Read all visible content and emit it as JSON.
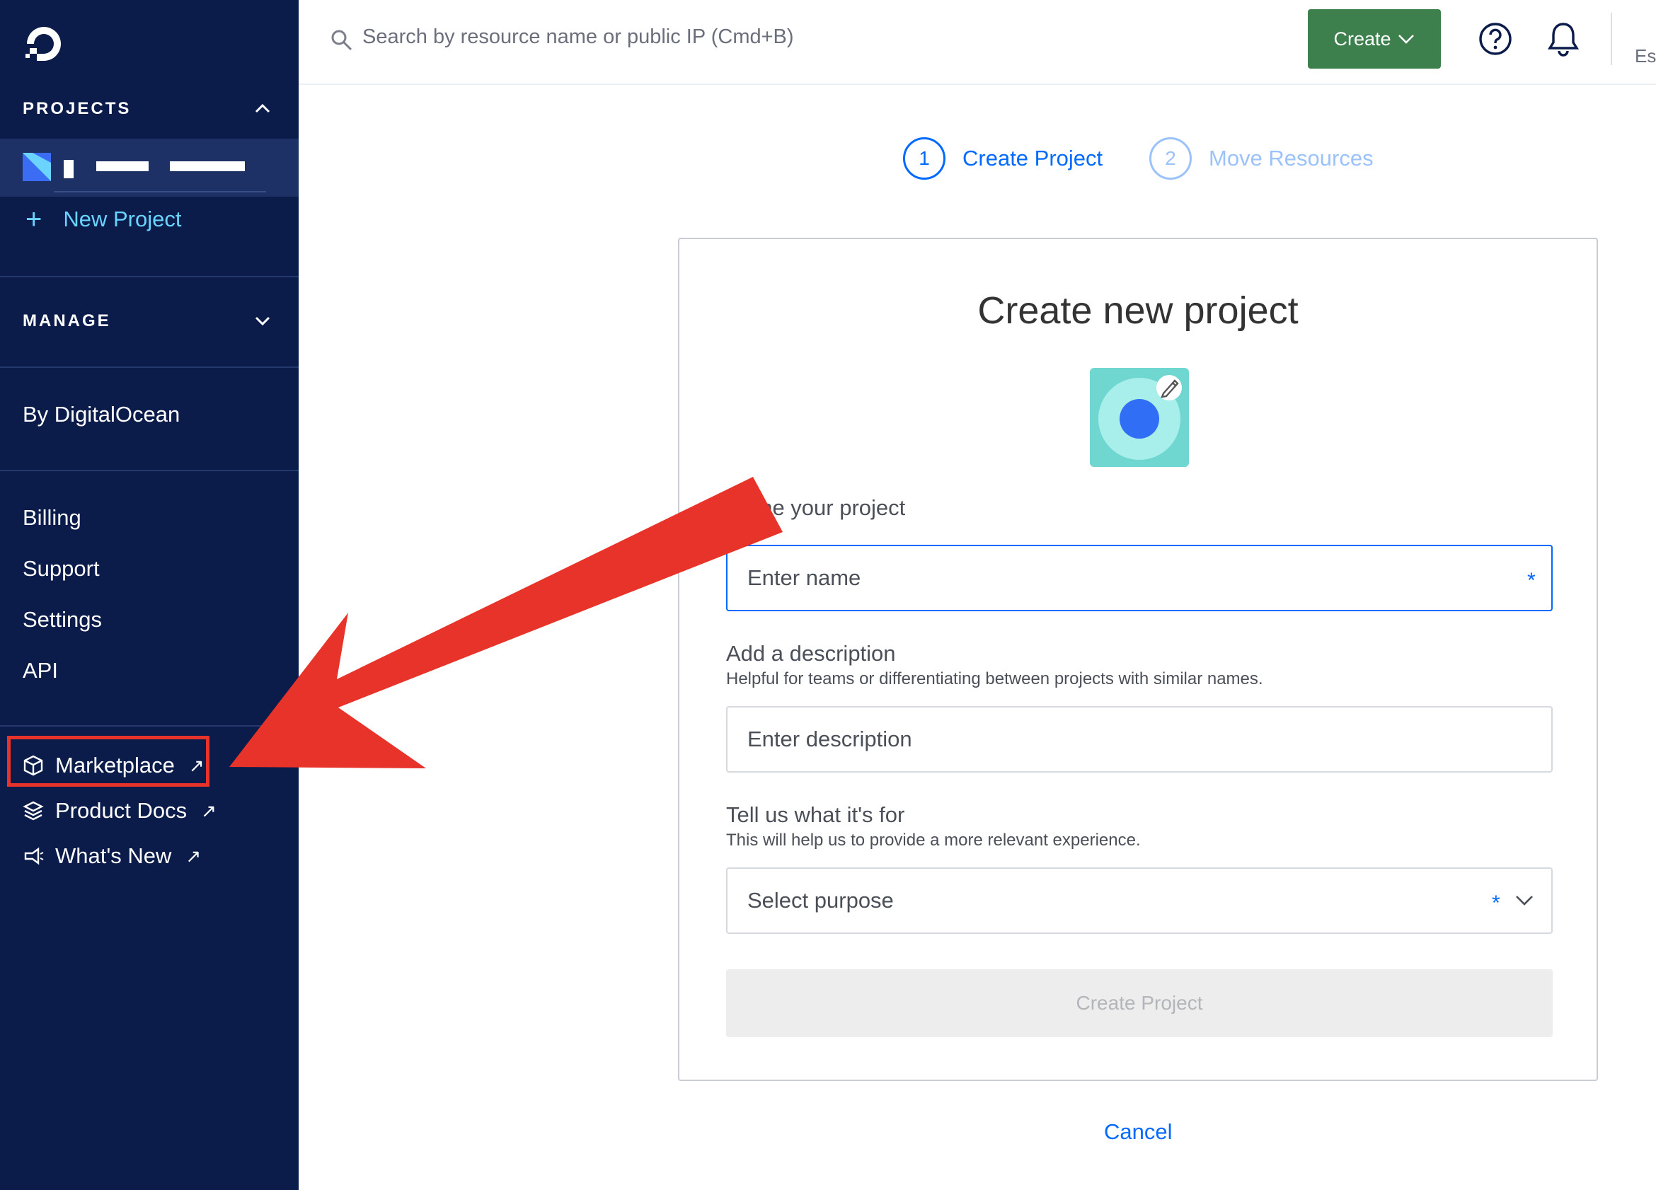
{
  "colors": {
    "sidebar_bg": "#0b1b4a",
    "sidebar_selected_bg": "#1e3166",
    "accent_blue": "#0069ff",
    "create_button_green": "#3d7f4d",
    "annotation_red": "#e8332a",
    "avatar_teal": "#6fd6d0"
  },
  "sidebar": {
    "projects_heading": "PROJECTS",
    "new_project_label": "New Project",
    "manage_heading": "MANAGE",
    "by_digitalocean_label": "By DigitalOcean",
    "nav_items": [
      {
        "label": "Billing"
      },
      {
        "label": "Support"
      },
      {
        "label": "Settings"
      },
      {
        "label": "API"
      }
    ],
    "external_links": [
      {
        "label": "Marketplace",
        "icon": "cube-icon",
        "arrow": "↗"
      },
      {
        "label": "Product Docs",
        "icon": "layers-icon",
        "arrow": "↗"
      },
      {
        "label": "What's New",
        "icon": "megaphone-icon",
        "arrow": "↗"
      }
    ]
  },
  "topbar": {
    "search_placeholder": "Search by resource name or public IP (Cmd+B)",
    "create_label": "Create",
    "truncated_text": "Es"
  },
  "stepper": {
    "steps": [
      {
        "number": "1",
        "label": "Create Project",
        "state": "active"
      },
      {
        "number": "2",
        "label": "Move Resources",
        "state": "inactive"
      }
    ]
  },
  "form": {
    "title": "Create new project",
    "name_label": "Name your project",
    "name_placeholder": "Enter name",
    "required_mark": "*",
    "description_label": "Add a description",
    "description_help": "Helpful for teams or differentiating between projects with similar names.",
    "description_placeholder": "Enter description",
    "purpose_label": "Tell us what it's for",
    "purpose_help": "This will help us to provide a more relevant experience.",
    "purpose_placeholder": "Select purpose",
    "submit_label": "Create Project",
    "cancel_label": "Cancel"
  }
}
